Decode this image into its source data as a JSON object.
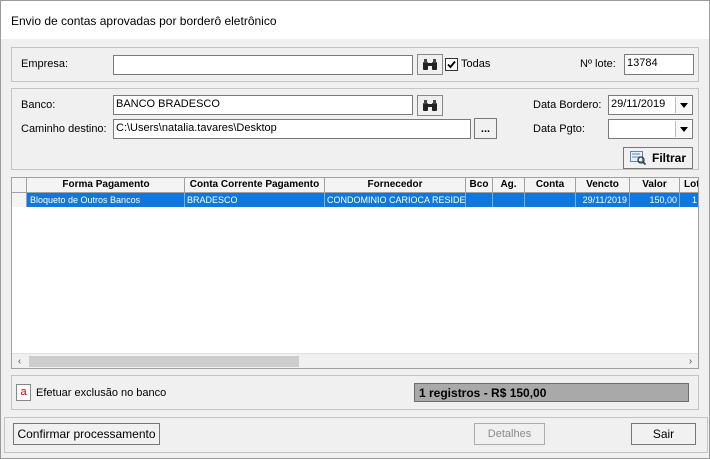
{
  "window": {
    "title": "Envio de contas aprovadas por borderô eletrônico"
  },
  "empresa": {
    "label": "Empresa:",
    "value": "",
    "search_icon": "binoculars-icon",
    "todas_label": "Todas",
    "todas_checked": true
  },
  "lote": {
    "label": "Nº lote:",
    "value": "13784"
  },
  "banco": {
    "label": "Banco:",
    "value": "BANCO BRADESCO",
    "search_icon": "binoculars-icon"
  },
  "caminho": {
    "label": "Caminho destino:",
    "value": "C:\\Users\\natalia.tavares\\Desktop",
    "browse_label": "..."
  },
  "data_bordero": {
    "label": "Data Bordero:",
    "value": "29/11/2019"
  },
  "data_pgto": {
    "label": "Data Pgto:",
    "value": ""
  },
  "filtrar": {
    "label": "Filtrar"
  },
  "grid": {
    "columns": [
      "Forma Pagamento",
      "Conta Corrente Pagamento",
      "Fornecedor",
      "Bco",
      "Ag.",
      "Conta",
      "Vencto",
      "Valor",
      "Lot"
    ],
    "rows": [
      [
        "Bloqueto de Outros Bancos",
        "BRADESCO",
        "CONDOMINIO CARIOCA RESIDENC",
        "",
        "",
        "",
        "29/11/2019",
        "150,00",
        "1"
      ]
    ]
  },
  "exclusao": {
    "checkbox_mark": "a",
    "label": "Efetuar exclusão no banco"
  },
  "summary": {
    "text": "1 registros - R$ 150,00"
  },
  "footer": {
    "confirmar_label": "Confirmar processamento",
    "detalhes_label": "Detalhes",
    "sair_label": "Sair"
  }
}
